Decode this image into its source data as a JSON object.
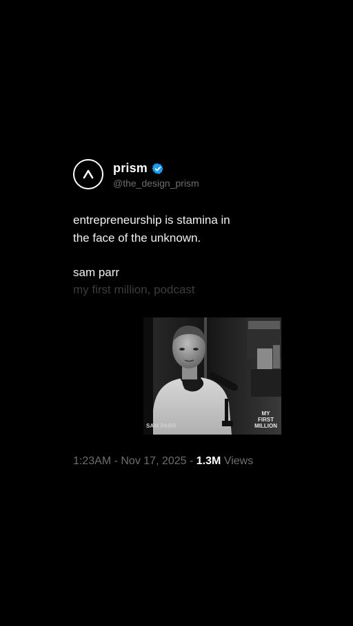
{
  "profile": {
    "display_name": "prism",
    "handle": "@the_design_prism",
    "avatar_icon": "caret-up-icon",
    "verified_icon": "verified-badge-icon",
    "verified_color": "#1d9bf0"
  },
  "post": {
    "quote_lines": [
      "entrepreneurship is stamina in",
      "the face of the unknown."
    ],
    "author": "sam parr",
    "source": "my first million, podcast"
  },
  "media": {
    "caption": "SAM PARR",
    "logo_lines": [
      "MY",
      "FIRST",
      "MILLION"
    ]
  },
  "meta": {
    "time": "1:23AM",
    "separator": "-",
    "date": "Nov 17, 2025",
    "views_count": "1.3M",
    "views_label": "Views"
  },
  "colors": {
    "background": "#000000",
    "primary_text": "#ffffff",
    "muted_text": "#6e6e6e",
    "faded_text": "#3c3c3c"
  }
}
